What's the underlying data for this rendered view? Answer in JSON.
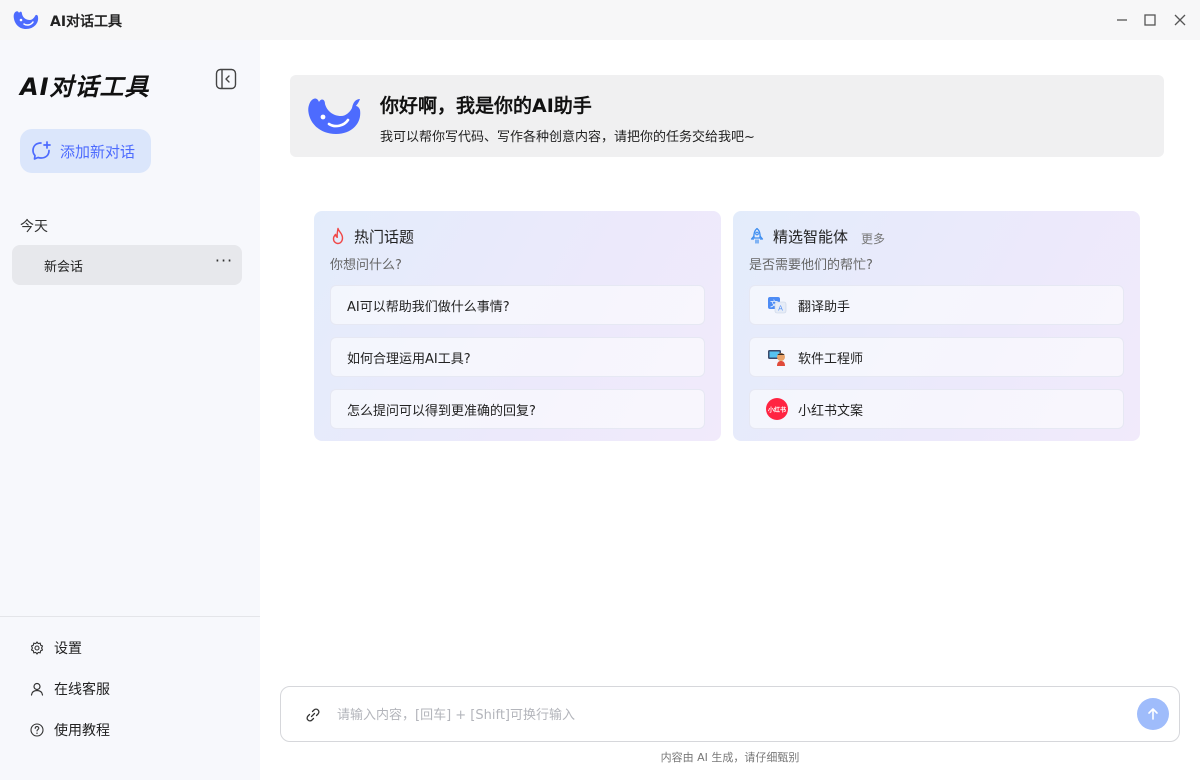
{
  "window": {
    "title": "AI对话工具"
  },
  "sidebar": {
    "brand": "AI对话工具",
    "new_chat_label": "添加新对话",
    "section_today": "今天",
    "sessions": [
      {
        "label": "新会话",
        "more": "···"
      }
    ],
    "bottom_items": [
      {
        "label": "设置",
        "icon": "gear-icon"
      },
      {
        "label": "在线客服",
        "icon": "user-icon"
      },
      {
        "label": "使用教程",
        "icon": "help-icon"
      }
    ]
  },
  "welcome": {
    "title": "你好啊，我是你的AI助手",
    "subtitle": "我可以帮你写代码、写作各种创意内容，请把你的任务交给我吧~"
  },
  "hot_topics": {
    "title": "热门话题",
    "subtitle": "你想问什么?",
    "items": [
      "AI可以帮助我们做什么事情?",
      "如何合理运用AI工具?",
      "怎么提问可以得到更准确的回复?"
    ]
  },
  "agents": {
    "title": "精选智能体",
    "more": "更多",
    "subtitle": "是否需要他们的帮忙?",
    "items": [
      {
        "label": "翻译助手",
        "icon": "translate-icon"
      },
      {
        "label": "软件工程师",
        "icon": "engineer-icon"
      },
      {
        "label": "小红书文案",
        "icon": "xiaohongshu-icon",
        "icon_text": "小红书"
      }
    ]
  },
  "input": {
    "placeholder": "请输入内容，[回车] + [Shift]可换行输入"
  },
  "footnote": "内容由 AI 生成，请仔细甄别",
  "colors": {
    "accent": "#4d6bfe",
    "send_button": "#9fbcfb",
    "sidebar_bg": "#f7f8fc",
    "xiaohongshu_red": "#ff2442"
  }
}
